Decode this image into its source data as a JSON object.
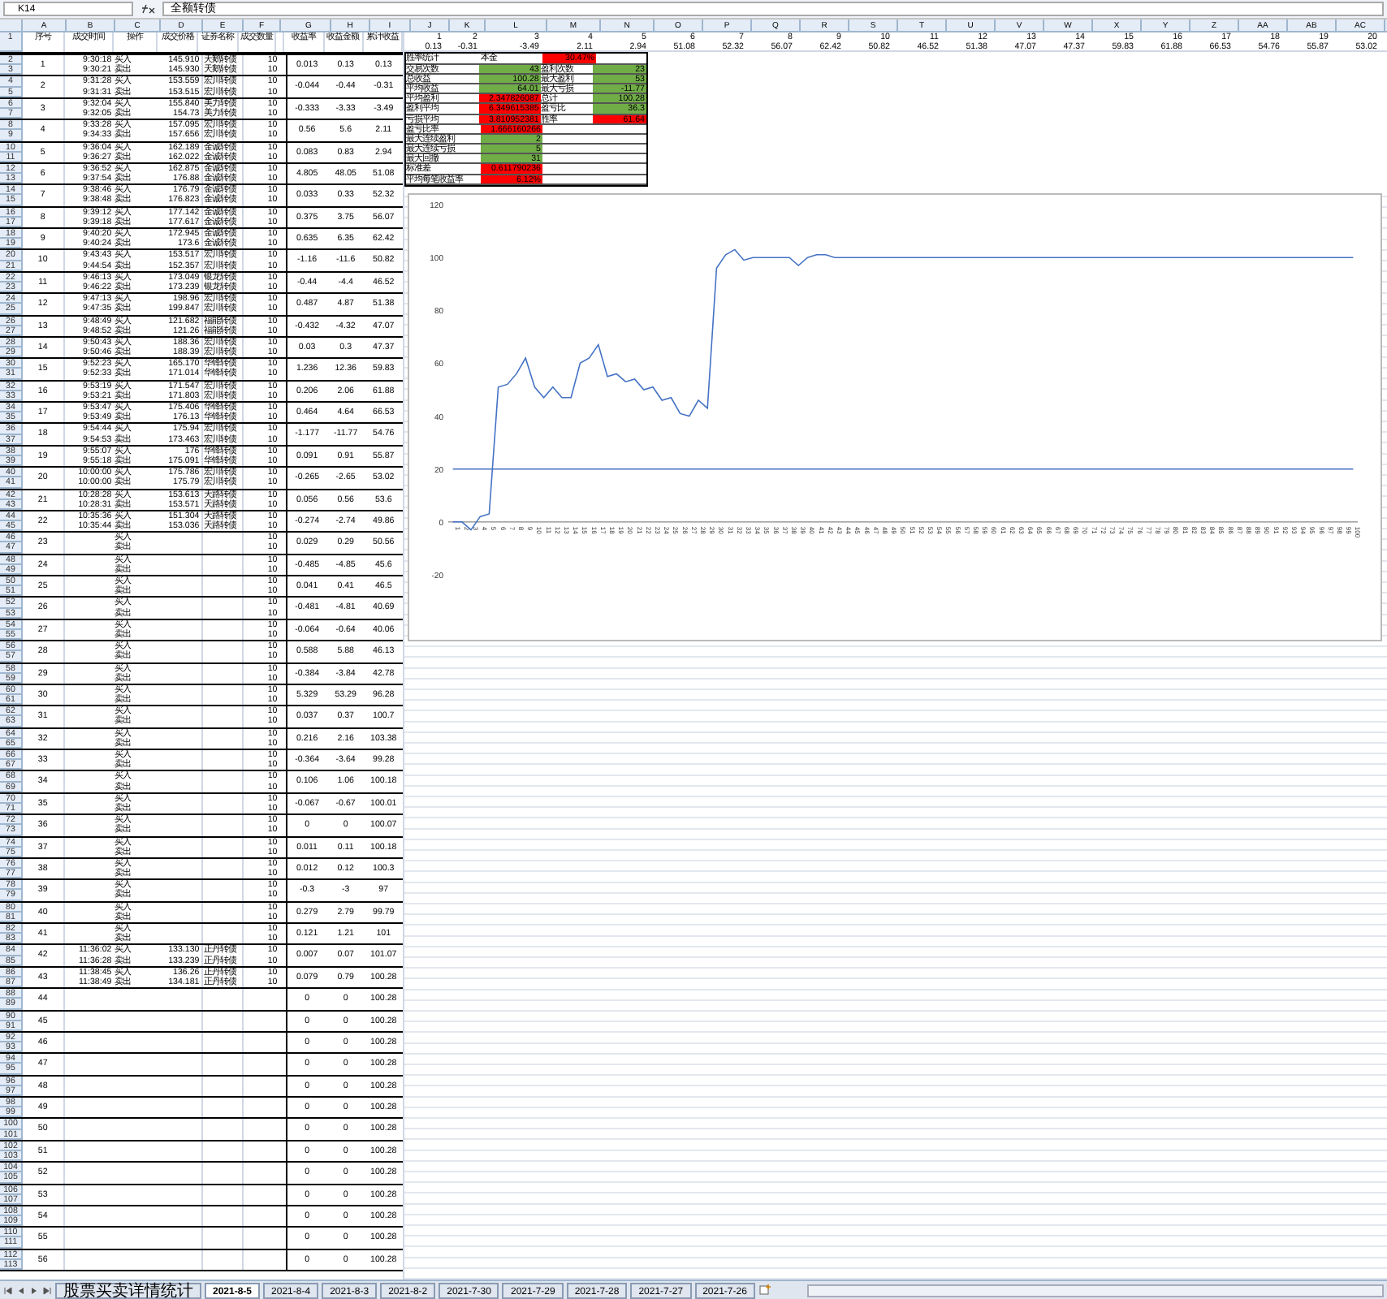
{
  "formula_bar": {
    "name_box": "K14",
    "formula": "全额转债"
  },
  "columns_left": [
    "A",
    "B",
    "C",
    "D",
    "E",
    "F",
    "G",
    "H",
    "I"
  ],
  "columns_right": [
    "J",
    "K",
    "L",
    "M",
    "N",
    "O",
    "P",
    "Q",
    "R",
    "S",
    "T",
    "U",
    "V",
    "W",
    "X",
    "Y",
    "Z",
    "AA",
    "AB",
    "AC"
  ],
  "row_numbers": [
    "1",
    "2",
    "3",
    "4",
    "5",
    "6",
    "7",
    "8",
    "9",
    "10",
    "11",
    "12",
    "13",
    "14",
    "15",
    "16",
    "17",
    "18",
    "19",
    "20",
    "21",
    "22",
    "23",
    "24",
    "25",
    "26",
    "27",
    "28",
    "29",
    "30",
    "31",
    "32",
    "33",
    "34",
    "35",
    "36",
    "37",
    "38",
    "39",
    "40",
    "41",
    "42",
    "43",
    "44",
    "45",
    "46",
    "47",
    "48",
    "49",
    "50",
    "51",
    "52",
    "53",
    "54",
    "55",
    "56",
    "57",
    "58",
    "59",
    "60",
    "61",
    "62",
    "63",
    "64",
    "65",
    "66",
    "67",
    "68",
    "69",
    "70",
    "71",
    "72",
    "73",
    "74",
    "75",
    "76",
    "77",
    "78",
    "79",
    "80",
    "81",
    "82",
    "83",
    "84",
    "85",
    "86",
    "87",
    "88",
    "89",
    "90",
    "91",
    "92",
    "93",
    "94",
    "95",
    "96",
    "97",
    "98",
    "99",
    "100",
    "101",
    "102",
    "103",
    "104",
    "105",
    "106",
    "107",
    "108",
    "109",
    "110",
    "111",
    "112",
    "113"
  ],
  "trade_table": {
    "headers": [
      "序号",
      "成交时间",
      "操作",
      "成交价格",
      "证券名称",
      "成交数量",
      "收益率",
      "收益金额",
      "累计收益"
    ],
    "groups": [
      {
        "no": "1",
        "trades": [
          {
            "time": "9:30:18",
            "action": "买入",
            "price": "145.910",
            "name": "天鹅转债",
            "qty": "10"
          },
          {
            "time": "9:30:21",
            "action": "卖出",
            "price": "145.930",
            "name": "天鹅转债",
            "qty": "10"
          }
        ],
        "rate": "0.013",
        "amount": "0.13",
        "total": "0.13"
      },
      {
        "no": "2",
        "trades": [
          {
            "time": "9:31:28",
            "action": "买入",
            "price": "153.559",
            "name": "宏川转债",
            "qty": "10"
          },
          {
            "time": "9:31:31",
            "action": "卖出",
            "price": "153.515",
            "name": "宏川转债",
            "qty": "10"
          }
        ],
        "rate": "-0.044",
        "amount": "-0.44",
        "total": "-0.31"
      },
      {
        "no": "3",
        "trades": [
          {
            "time": "9:32:04",
            "action": "买入",
            "price": "155.840",
            "name": "美力转债",
            "qty": "10"
          },
          {
            "time": "9:32:05",
            "action": "卖出",
            "price": "154.73",
            "name": "美力转债",
            "qty": "10"
          }
        ],
        "rate": "-0.333",
        "amount": "-3.33",
        "total": "-3.49"
      },
      {
        "no": "4",
        "trades": [
          {
            "time": "9:33:28",
            "action": "买入",
            "price": "157.095",
            "name": "宏川转债",
            "qty": "10"
          },
          {
            "time": "9:34:33",
            "action": "卖出",
            "price": "157.656",
            "name": "宏川转债",
            "qty": "10"
          }
        ],
        "rate": "0.56",
        "amount": "5.6",
        "total": "2.11"
      },
      {
        "no": "5",
        "trades": [
          {
            "time": "9:36:04",
            "action": "买入",
            "price": "162.189",
            "name": "金诚转债",
            "qty": "10"
          },
          {
            "time": "9:36:27",
            "action": "卖出",
            "price": "162.022",
            "name": "金诚转债",
            "qty": "10"
          }
        ],
        "rate": "0.083",
        "amount": "0.83",
        "total": "2.94"
      },
      {
        "no": "6",
        "trades": [
          {
            "time": "9:36:52",
            "action": "买入",
            "price": "162.875",
            "name": "金诚转债",
            "qty": "10"
          },
          {
            "time": "9:37:54",
            "action": "卖出",
            "price": "176.88",
            "name": "金诚转债",
            "qty": "10"
          }
        ],
        "rate": "4.805",
        "amount": "48.05",
        "total": "51.08"
      },
      {
        "no": "7",
        "trades": [
          {
            "time": "9:38:46",
            "action": "买入",
            "price": "176.79",
            "name": "金诚转债",
            "qty": "10"
          },
          {
            "time": "9:38:48",
            "action": "卖出",
            "price": "176.823",
            "name": "金诚转债",
            "qty": "10"
          }
        ],
        "rate": "0.033",
        "amount": "0.33",
        "total": "52.32"
      },
      {
        "no": "8",
        "trades": [
          {
            "time": "9:39:12",
            "action": "买入",
            "price": "177.142",
            "name": "金诚转债",
            "qty": "10"
          },
          {
            "time": "9:39:18",
            "action": "卖出",
            "price": "177.617",
            "name": "金诚转债",
            "qty": "10"
          }
        ],
        "rate": "0.375",
        "amount": "3.75",
        "total": "56.07"
      },
      {
        "no": "9",
        "trades": [
          {
            "time": "9:40:20",
            "action": "买入",
            "price": "172.945",
            "name": "金诚转债",
            "qty": "10"
          },
          {
            "time": "9:40:24",
            "action": "卖出",
            "price": "173.6",
            "name": "金诚转债",
            "qty": "10"
          }
        ],
        "rate": "0.635",
        "amount": "6.35",
        "total": "62.42"
      },
      {
        "no": "10",
        "trades": [
          {
            "time": "9:43:43",
            "action": "买入",
            "price": "153.517",
            "name": "宏川转债",
            "qty": "10"
          },
          {
            "time": "9:44:54",
            "action": "卖出",
            "price": "152.357",
            "name": "宏川转债",
            "qty": "10"
          }
        ],
        "rate": "-1.16",
        "amount": "-11.6",
        "total": "50.82"
      },
      {
        "no": "11",
        "trades": [
          {
            "time": "9:46:13",
            "action": "买入",
            "price": "173.049",
            "name": "银龙转债",
            "qty": "10"
          },
          {
            "time": "9:46:22",
            "action": "卖出",
            "price": "173.239",
            "name": "银龙转债",
            "qty": "10"
          }
        ],
        "rate": "-0.44",
        "amount": "-4.4",
        "total": "46.52"
      },
      {
        "no": "12",
        "trades": [
          {
            "time": "9:47:13",
            "action": "买入",
            "price": "198.96",
            "name": "宏川转债",
            "qty": "10"
          },
          {
            "time": "9:47:35",
            "action": "卖出",
            "price": "199.847",
            "name": "宏川转债",
            "qty": "10"
          }
        ],
        "rate": "0.487",
        "amount": "4.87",
        "total": "51.38"
      },
      {
        "no": "13",
        "trades": [
          {
            "time": "9:48:49",
            "action": "买入",
            "price": "121.682",
            "name": "福能转债",
            "qty": "10"
          },
          {
            "time": "9:48:52",
            "action": "卖出",
            "price": "121.26",
            "name": "福能转债",
            "qty": "10"
          }
        ],
        "rate": "-0.432",
        "amount": "-4.32",
        "total": "47.07"
      },
      {
        "no": "14",
        "trades": [
          {
            "time": "9:50:43",
            "action": "买入",
            "price": "188.36",
            "name": "宏川转债",
            "qty": "10"
          },
          {
            "time": "9:50:46",
            "action": "卖出",
            "price": "188.39",
            "name": "宏川转债",
            "qty": "10"
          }
        ],
        "rate": "0.03",
        "amount": "0.3",
        "total": "47.37"
      },
      {
        "no": "15",
        "trades": [
          {
            "time": "9:52:23",
            "action": "买入",
            "price": "165.170",
            "name": "华锋转债",
            "qty": "10"
          },
          {
            "time": "9:52:33",
            "action": "卖出",
            "price": "171.014",
            "name": "华锋转债",
            "qty": "10"
          }
        ],
        "rate": "1.236",
        "amount": "12.36",
        "total": "59.83"
      },
      {
        "no": "16",
        "trades": [
          {
            "time": "9:53:19",
            "action": "买入",
            "price": "171.547",
            "name": "宏川转债",
            "qty": "10"
          },
          {
            "time": "9:53:21",
            "action": "卖出",
            "price": "171.803",
            "name": "宏川转债",
            "qty": "10"
          }
        ],
        "rate": "0.206",
        "amount": "2.06",
        "total": "61.88"
      },
      {
        "no": "17",
        "trades": [
          {
            "time": "9:53:47",
            "action": "买入",
            "price": "175.406",
            "name": "华锋转债",
            "qty": "10"
          },
          {
            "time": "9:53:49",
            "action": "卖出",
            "price": "176.13",
            "name": "华锋转债",
            "qty": "10"
          }
        ],
        "rate": "0.464",
        "amount": "4.64",
        "total": "66.53"
      },
      {
        "no": "18",
        "trades": [
          {
            "time": "9:54:44",
            "action": "买入",
            "price": "175.94",
            "name": "宏川转债",
            "qty": "10"
          },
          {
            "time": "9:54:53",
            "action": "卖出",
            "price": "173.463",
            "name": "宏川转债",
            "qty": "10"
          }
        ],
        "rate": "-1.177",
        "amount": "-11.77",
        "total": "54.76"
      },
      {
        "no": "19",
        "trades": [
          {
            "time": "9:55:07",
            "action": "买入",
            "price": "176",
            "name": "华锋转债",
            "qty": "10"
          },
          {
            "time": "9:55:18",
            "action": "卖出",
            "price": "175.091",
            "name": "华锋转债",
            "qty": "10"
          }
        ],
        "rate": "0.091",
        "amount": "0.91",
        "total": "55.87"
      },
      {
        "no": "20",
        "trades": [
          {
            "time": "10:00:00",
            "action": "买入",
            "price": "175.786",
            "name": "宏川转债",
            "qty": "10"
          },
          {
            "time": "10:00:00",
            "action": "卖出",
            "price": "175.79",
            "name": "宏川转债",
            "qty": "10"
          }
        ],
        "rate": "-0.265",
        "amount": "-2.65",
        "total": "53.02"
      },
      {
        "no": "21",
        "trades": [
          {
            "time": "10:28:28",
            "action": "买入",
            "price": "153.613",
            "name": "天路转债",
            "qty": "10"
          },
          {
            "time": "10:28:31",
            "action": "卖出",
            "price": "153.571",
            "name": "天路转债",
            "qty": "10"
          }
        ],
        "rate": "0.056",
        "amount": "0.56",
        "total": "53.6"
      },
      {
        "no": "22",
        "trades": [
          {
            "time": "10:35:36",
            "action": "买入",
            "price": "151.304",
            "name": "天路转债",
            "qty": "10"
          },
          {
            "time": "10:35:44",
            "action": "卖出",
            "price": "153.036",
            "name": "天路转债",
            "qty": "10"
          }
        ],
        "rate": "-0.274",
        "amount": "-2.74",
        "total": "49.86"
      },
      {
        "no": "23",
        "trades": [
          {
            "action": "买入",
            "qty": "10"
          },
          {
            "action": "卖出",
            "qty": "10"
          }
        ],
        "rate": "0.029",
        "amount": "0.29",
        "total": "50.56"
      },
      {
        "no": "24",
        "trades": [
          {
            "action": "买入",
            "qty": "10"
          },
          {
            "action": "卖出",
            "qty": "10"
          }
        ],
        "rate": "-0.485",
        "amount": "-4.85",
        "total": "45.6"
      },
      {
        "no": "25",
        "trades": [
          {
            "action": "买入",
            "qty": "10"
          },
          {
            "action": "卖出",
            "qty": "10"
          }
        ],
        "rate": "0.041",
        "amount": "0.41",
        "total": "46.5"
      },
      {
        "no": "26",
        "trades": [
          {
            "action": "买入",
            "qty": "10"
          },
          {
            "action": "卖出",
            "qty": "10"
          }
        ],
        "rate": "-0.481",
        "amount": "-4.81",
        "total": "40.69"
      },
      {
        "no": "27",
        "trades": [
          {
            "action": "买入",
            "qty": "10"
          },
          {
            "action": "卖出",
            "qty": "10"
          }
        ],
        "rate": "-0.064",
        "amount": "-0.64",
        "total": "40.06"
      },
      {
        "no": "28",
        "trades": [
          {
            "action": "买入",
            "qty": "10"
          },
          {
            "action": "卖出",
            "qty": "10"
          }
        ],
        "rate": "0.588",
        "amount": "5.88",
        "total": "46.13"
      },
      {
        "no": "29",
        "trades": [
          {
            "action": "买入",
            "qty": "10"
          },
          {
            "action": "卖出",
            "qty": "10"
          }
        ],
        "rate": "-0.384",
        "amount": "-3.84",
        "total": "42.78"
      },
      {
        "no": "30",
        "trades": [
          {
            "action": "买入",
            "qty": "10"
          },
          {
            "action": "卖出",
            "qty": "10"
          }
        ],
        "rate": "5.329",
        "amount": "53.29",
        "total": "96.28"
      },
      {
        "no": "31",
        "trades": [
          {
            "action": "买入",
            "qty": "10"
          },
          {
            "action": "卖出",
            "qty": "10"
          }
        ],
        "rate": "0.037",
        "amount": "0.37",
        "total": "100.7"
      },
      {
        "no": "32",
        "trades": [
          {
            "action": "买入",
            "qty": "10"
          },
          {
            "action": "卖出",
            "qty": "10"
          }
        ],
        "rate": "0.216",
        "amount": "2.16",
        "total": "103.38"
      },
      {
        "no": "33",
        "trades": [
          {
            "action": "买入",
            "qty": "10"
          },
          {
            "action": "卖出",
            "qty": "10"
          }
        ],
        "rate": "-0.364",
        "amount": "-3.64",
        "total": "99.28"
      },
      {
        "no": "34",
        "trades": [
          {
            "action": "买入",
            "qty": "10"
          },
          {
            "action": "卖出",
            "qty": "10"
          }
        ],
        "rate": "0.106",
        "amount": "1.06",
        "total": "100.18"
      },
      {
        "no": "35",
        "trades": [
          {
            "action": "买入",
            "qty": "10"
          },
          {
            "action": "卖出",
            "qty": "10"
          }
        ],
        "rate": "-0.067",
        "amount": "-0.67",
        "total": "100.01"
      },
      {
        "no": "36",
        "trades": [
          {
            "action": "买入",
            "qty": "10"
          },
          {
            "action": "卖出",
            "qty": "10"
          }
        ],
        "rate": "0",
        "amount": "0",
        "total": "100.07"
      },
      {
        "no": "37",
        "trades": [
          {
            "action": "买入",
            "qty": "10"
          },
          {
            "action": "卖出",
            "qty": "10"
          }
        ],
        "rate": "0.011",
        "amount": "0.11",
        "total": "100.18"
      },
      {
        "no": "38",
        "trades": [
          {
            "action": "买入",
            "qty": "10"
          },
          {
            "action": "卖出",
            "qty": "10"
          }
        ],
        "rate": "0.012",
        "amount": "0.12",
        "total": "100.3"
      },
      {
        "no": "39",
        "trades": [
          {
            "action": "买入",
            "qty": "10"
          },
          {
            "action": "卖出",
            "qty": "10"
          }
        ],
        "rate": "-0.3",
        "amount": "-3",
        "total": "97"
      },
      {
        "no": "40",
        "trades": [
          {
            "action": "买入",
            "qty": "10"
          },
          {
            "action": "卖出",
            "qty": "10"
          }
        ],
        "rate": "0.279",
        "amount": "2.79",
        "total": "99.79"
      },
      {
        "no": "41",
        "trades": [
          {
            "action": "买入",
            "qty": "10"
          },
          {
            "action": "卖出",
            "qty": "10"
          }
        ],
        "rate": "0.121",
        "amount": "1.21",
        "total": "101"
      },
      {
        "no": "42",
        "trades": [
          {
            "time": "11:36:02",
            "action": "买入",
            "price": "133.130",
            "name": "正丹转债",
            "qty": "10"
          },
          {
            "time": "11:36:28",
            "action": "卖出",
            "price": "133.239",
            "name": "正丹转债",
            "qty": "10"
          }
        ],
        "rate": "0.007",
        "amount": "0.07",
        "total": "101.07"
      },
      {
        "no": "43",
        "trades": [
          {
            "time": "11:38:45",
            "action": "买入",
            "price": "136.26",
            "name": "正丹转债",
            "qty": "10"
          },
          {
            "time": "11:38:49",
            "action": "卖出",
            "price": "134.181",
            "name": "正丹转债",
            "qty": "10"
          }
        ],
        "rate": "0.079",
        "amount": "0.79",
        "total": "100.28"
      },
      {
        "no": "44",
        "rate": "0",
        "amount": "0",
        "total": "100.28"
      },
      {
        "no": "45",
        "rate": "0",
        "amount": "0",
        "total": "100.28"
      },
      {
        "no": "46",
        "rate": "0",
        "amount": "0",
        "total": "100.28"
      },
      {
        "no": "47",
        "rate": "0",
        "amount": "0",
        "total": "100.28"
      },
      {
        "no": "48",
        "rate": "0",
        "amount": "0",
        "total": "100.28"
      },
      {
        "no": "49",
        "rate": "0",
        "amount": "0",
        "total": "100.28"
      },
      {
        "no": "50",
        "rate": "0",
        "amount": "0",
        "total": "100.28"
      },
      {
        "no": "51",
        "rate": "0",
        "amount": "0",
        "total": "100.28"
      },
      {
        "no": "52",
        "rate": "0",
        "amount": "0",
        "total": "100.28"
      },
      {
        "no": "53",
        "rate": "0",
        "amount": "0",
        "total": "100.28"
      },
      {
        "no": "54",
        "rate": "0",
        "amount": "0",
        "total": "100.28"
      },
      {
        "no": "55",
        "rate": "0",
        "amount": "0",
        "total": "100.28"
      },
      {
        "no": "56",
        "rate": "0",
        "amount": "0",
        "total": "100.28"
      }
    ]
  },
  "transposed": {
    "indices": [
      "1",
      "2",
      "3",
      "4",
      "5",
      "6",
      "7",
      "8",
      "9",
      "10",
      "11",
      "12",
      "13",
      "14",
      "15",
      "16",
      "17",
      "18",
      "19",
      "20"
    ],
    "values": [
      "0.13",
      "-0.31",
      "-3.49",
      "2.11",
      "2.94",
      "51.08",
      "52.32",
      "56.07",
      "62.42",
      "50.82",
      "46.52",
      "51.38",
      "47.07",
      "47.37",
      "59.83",
      "61.88",
      "66.53",
      "54.76",
      "55.87",
      "53.02"
    ]
  },
  "stats": [
    [
      {
        "text": "胜率统计",
        "kind": "label"
      },
      {
        "text": "本金",
        "kind": "plain"
      },
      {
        "text": "30.47%",
        "kind": "bad"
      }
    ],
    [
      {
        "text": "交易次数",
        "kind": "label"
      },
      {
        "text": "43",
        "kind": "good"
      },
      {
        "text": "盈利次数",
        "kind": "label"
      },
      {
        "text": "23",
        "kind": "good"
      }
    ],
    [
      {
        "text": "总收益",
        "kind": "label"
      },
      {
        "text": "100.28",
        "kind": "good"
      },
      {
        "text": "最大盈利",
        "kind": "label"
      },
      {
        "text": "53",
        "kind": "good"
      }
    ],
    [
      {
        "text": "平均收益",
        "kind": "label"
      },
      {
        "text": "64.01",
        "kind": "good"
      },
      {
        "text": "最大亏损",
        "kind": "label"
      },
      {
        "text": "-11.77",
        "kind": "good"
      }
    ],
    [
      {
        "text": "平均盈利",
        "kind": "label"
      },
      {
        "text": "2.347826087",
        "kind": "bad"
      },
      {
        "text": "总计",
        "kind": "label"
      },
      {
        "text": "100.28",
        "kind": "good"
      }
    ],
    [
      {
        "text": "盈利平均",
        "kind": "label"
      },
      {
        "text": "6.349615385",
        "kind": "bad"
      },
      {
        "text": "盈亏比",
        "kind": "label"
      },
      {
        "text": "36.3",
        "kind": "good"
      }
    ],
    [
      {
        "text": "亏损平均",
        "kind": "label"
      },
      {
        "text": "3.810952381",
        "kind": "bad"
      },
      {
        "text": "胜率",
        "kind": "label"
      },
      {
        "text": "61.64",
        "kind": "bad"
      }
    ],
    [
      {
        "text": "盈亏比率",
        "kind": "label"
      },
      {
        "text": "1.666160266",
        "kind": "bad"
      }
    ],
    [
      {
        "text": "最大连续盈利",
        "kind": "label"
      },
      {
        "text": "2",
        "kind": "good"
      }
    ],
    [
      {
        "text": "最大连续亏损",
        "kind": "label"
      },
      {
        "text": "5",
        "kind": "good"
      }
    ],
    [
      {
        "text": "最大回撤",
        "kind": "label"
      },
      {
        "text": "31",
        "kind": "good"
      }
    ],
    [
      {
        "text": "标准差",
        "kind": "label"
      },
      {
        "text": "0.611790236",
        "kind": "bad"
      }
    ],
    [
      {
        "text": "平均每笔收益率",
        "kind": "label"
      },
      {
        "text": "6.12%",
        "kind": "bad"
      }
    ]
  ],
  "chart": {
    "chart_data": {
      "type": "line",
      "ylim": [
        -20,
        120
      ],
      "yticks": [
        -20,
        0,
        20,
        40,
        60,
        80,
        100,
        120
      ],
      "x": [
        "1",
        "2",
        "3",
        "4",
        "5",
        "6",
        "7",
        "8",
        "9",
        "10",
        "11",
        "12",
        "13",
        "14",
        "15",
        "16",
        "17",
        "18",
        "19",
        "20",
        "21",
        "22",
        "23",
        "24",
        "25",
        "26",
        "27",
        "28",
        "29",
        "30",
        "31",
        "32",
        "33",
        "34",
        "35",
        "36",
        "37",
        "38",
        "39",
        "40",
        "41",
        "42",
        "43",
        "44",
        "45",
        "46",
        "47",
        "48",
        "49",
        "50",
        "51",
        "52",
        "53",
        "54",
        "55",
        "56",
        "57",
        "58",
        "59",
        "60",
        "61",
        "62",
        "63",
        "64",
        "65",
        "66",
        "67",
        "68",
        "69",
        "70",
        "71",
        "72",
        "73",
        "74",
        "75",
        "76",
        "77",
        "78",
        "79",
        "80",
        "81",
        "82",
        "83",
        "84",
        "85",
        "86",
        "87",
        "88",
        "89",
        "90",
        "91",
        "92",
        "93",
        "94",
        "95",
        "96",
        "97",
        "98",
        "99",
        "100"
      ],
      "series": [
        {
          "color": "#4472c4",
          "values": [
            0,
            0,
            -3,
            2,
            3,
            51,
            52,
            56,
            62,
            51,
            47,
            51,
            47,
            47,
            60,
            62,
            67,
            55,
            56,
            53,
            54,
            50,
            51,
            46,
            47,
            41,
            40,
            46,
            43,
            96,
            101,
            103,
            99,
            100,
            100,
            100,
            100,
            100,
            97,
            100,
            101,
            101,
            100,
            100,
            100,
            100,
            100,
            100,
            100,
            100,
            100,
            100,
            100,
            100,
            100,
            100,
            100,
            100,
            100,
            100,
            100,
            100,
            100,
            100,
            100,
            100,
            100,
            100,
            100,
            100,
            100,
            100,
            100,
            100,
            100,
            100,
            100,
            100,
            100,
            100,
            100,
            100,
            100,
            100,
            100,
            100,
            100,
            100,
            100,
            100,
            100,
            100,
            100,
            100,
            100,
            100,
            100,
            100,
            100,
            100
          ]
        },
        {
          "color": "#4472c4",
          "values": [
            20,
            20,
            20,
            20,
            20,
            20,
            20,
            20,
            20,
            20,
            20,
            20,
            20,
            20,
            20,
            20,
            20,
            20,
            20,
            20,
            20,
            20,
            20,
            20,
            20,
            20,
            20,
            20,
            20,
            20,
            20,
            20,
            20,
            20,
            20,
            20,
            20,
            20,
            20,
            20,
            20,
            20,
            20,
            20,
            20,
            20,
            20,
            20,
            20,
            20,
            20,
            20,
            20,
            20,
            20,
            20,
            20,
            20,
            20,
            20,
            20,
            20,
            20,
            20,
            20,
            20,
            20,
            20,
            20,
            20,
            20,
            20,
            20,
            20,
            20,
            20,
            20,
            20,
            20,
            20,
            20,
            20,
            20,
            20,
            20,
            20,
            20,
            20,
            20,
            20,
            20,
            20,
            20,
            20,
            20,
            20,
            20,
            20,
            20,
            20
          ]
        }
      ]
    }
  },
  "sheet_tabs": [
    {
      "label": "股票买卖详情统计",
      "selected": false
    },
    {
      "label": "2021-8-5",
      "selected": true
    },
    {
      "label": "2021-8-4",
      "selected": false
    },
    {
      "label": "2021-8-3",
      "selected": false
    },
    {
      "label": "2021-8-2",
      "selected": false
    },
    {
      "label": "2021-7-30",
      "selected": false
    },
    {
      "label": "2021-7-29",
      "selected": false
    },
    {
      "label": "2021-7-28",
      "selected": false
    },
    {
      "label": "2021-7-27",
      "selected": false
    },
    {
      "label": "2021-7-26",
      "selected": false
    }
  ]
}
